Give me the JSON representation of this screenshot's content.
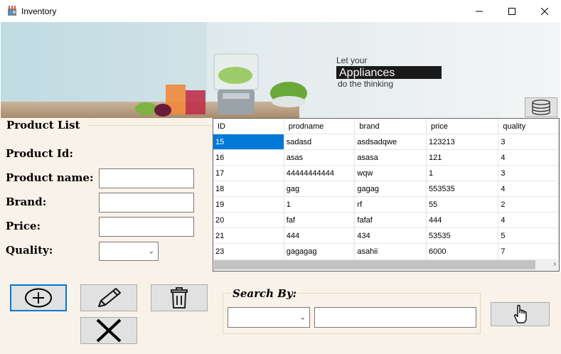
{
  "window": {
    "title": "Inventory",
    "minimize_icon": "minimize-icon",
    "maximize_icon": "maximize-icon",
    "close_icon": "close-icon"
  },
  "banner": {
    "line1": "Let your",
    "line2": "Appliances",
    "line3": "do the thinking"
  },
  "product_form": {
    "group_title": "Product List",
    "labels": {
      "id": "Product Id:",
      "name": "Product name:",
      "brand": "Brand:",
      "price": "Price:",
      "quality": "Quality:"
    },
    "values": {
      "name": "",
      "brand": "",
      "price": "",
      "quality": ""
    }
  },
  "grid": {
    "columns": [
      "ID",
      "prodname",
      "brand",
      "price",
      "quality"
    ],
    "rows": [
      [
        "15",
        "sadasd",
        "asdsadqwe",
        "123213",
        "3"
      ],
      [
        "16",
        "asas",
        "asasa",
        "121",
        "4"
      ],
      [
        "17",
        "44444444444",
        "wqw",
        "1",
        "3"
      ],
      [
        "18",
        "gag",
        "gagag",
        "553535",
        "4"
      ],
      [
        "19",
        "1",
        "rf",
        "55",
        "2"
      ],
      [
        "20",
        "faf",
        "fafaf",
        "444",
        "4"
      ],
      [
        "21",
        "444",
        "434",
        "53535",
        "5"
      ],
      [
        "23",
        "gagagag",
        "asahii",
        "6000",
        "7"
      ]
    ],
    "selected_row": 0
  },
  "search": {
    "title": "Search By:",
    "field_value": "",
    "query_value": ""
  },
  "icons": {
    "database": "database-icon",
    "add": "add-circle-icon",
    "edit": "pencil-icon",
    "delete": "trash-icon",
    "clear": "x-icon",
    "search": "hand-pointer-icon"
  },
  "colors": {
    "panel_bg": "#f9f2e8",
    "selection": "#0078d7",
    "button_bg": "#e1e1e1"
  }
}
